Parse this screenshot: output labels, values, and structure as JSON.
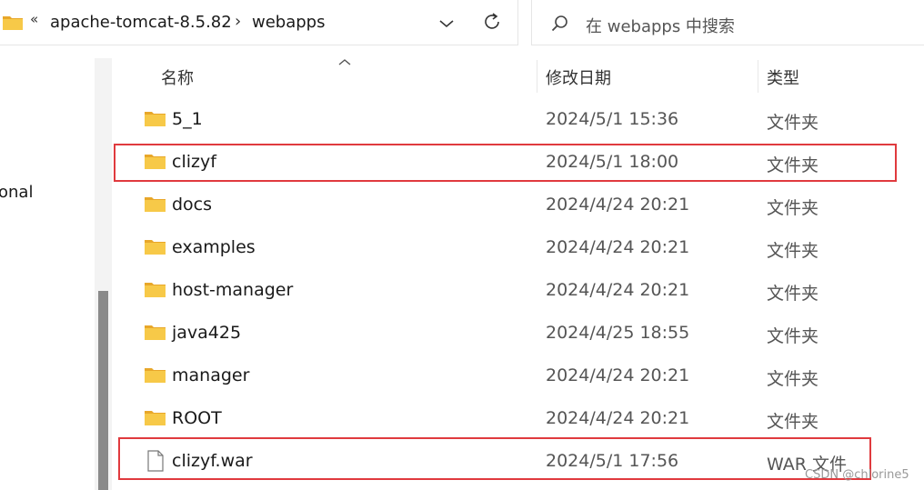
{
  "address_bar": {
    "overflow_glyph": "«",
    "crumbs": [
      "apache-tomcat-8.5.82",
      "webapps"
    ],
    "separator": "›"
  },
  "search": {
    "placeholder": "在 webapps 中搜索"
  },
  "left_pane": {
    "partial_text": "onal"
  },
  "columns": {
    "name": "名称",
    "date": "修改日期",
    "type": "类型"
  },
  "rows": [
    {
      "name": "5_1",
      "date": "2024/5/1 15:36",
      "type": "文件夹",
      "icon": "folder-icon"
    },
    {
      "name": "clizyf",
      "date": "2024/5/1 18:00",
      "type": "文件夹",
      "icon": "folder-icon"
    },
    {
      "name": "docs",
      "date": "2024/4/24 20:21",
      "type": "文件夹",
      "icon": "folder-icon"
    },
    {
      "name": "examples",
      "date": "2024/4/24 20:21",
      "type": "文件夹",
      "icon": "folder-icon"
    },
    {
      "name": "host-manager",
      "date": "2024/4/24 20:21",
      "type": "文件夹",
      "icon": "folder-icon"
    },
    {
      "name": "java425",
      "date": "2024/4/25 18:55",
      "type": "文件夹",
      "icon": "folder-icon"
    },
    {
      "name": "manager",
      "date": "2024/4/24 20:21",
      "type": "文件夹",
      "icon": "folder-icon"
    },
    {
      "name": "ROOT",
      "date": "2024/4/24 20:21",
      "type": "文件夹",
      "icon": "folder-icon"
    },
    {
      "name": "clizyf.war",
      "date": "2024/5/1 17:56",
      "type": "WAR 文件",
      "icon": "file-icon"
    }
  ],
  "watermark": "CSDN @chlorine5",
  "colors": {
    "highlight": "#e03a3e",
    "folder": "#f7c948"
  }
}
